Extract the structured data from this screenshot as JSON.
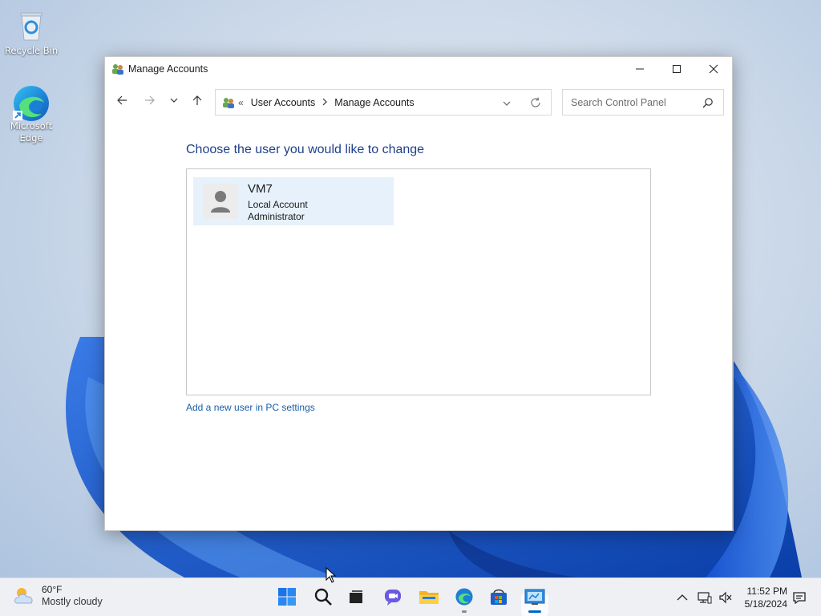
{
  "desktop": {
    "icons": [
      {
        "label": "Recycle Bin",
        "icon": "recycle-bin-icon"
      },
      {
        "label": "Microsoft Edge",
        "icon": "edge-icon"
      }
    ]
  },
  "window": {
    "title": "Manage Accounts",
    "controls": {
      "minimize": "minimize-icon",
      "maximize": "maximize-icon",
      "close": "close-icon"
    },
    "address_bar": {
      "overflow": "«",
      "breadcrumbs": [
        "User Accounts",
        "Manage Accounts"
      ]
    },
    "search": {
      "placeholder": "Search Control Panel"
    },
    "heading": "Choose the user you would like to change",
    "users": [
      {
        "name": "VM7",
        "type": "Local Account",
        "role": "Administrator"
      }
    ],
    "add_user_link": "Add a new user in PC settings"
  },
  "taskbar": {
    "weather": {
      "temp": "60°F",
      "condition": "Mostly cloudy"
    },
    "apps": [
      "start-icon",
      "search-icon",
      "task-view-icon",
      "chat-icon",
      "file-explorer-icon",
      "edge-icon",
      "store-icon",
      "control-panel-icon"
    ],
    "clock": {
      "time": "11:52 PM",
      "date": "5/18/2024"
    }
  },
  "colors": {
    "accent": "#0067c0",
    "heading": "#1e3f8a",
    "link": "#1a5ea8",
    "selected_tile": "#e6f1fb"
  }
}
